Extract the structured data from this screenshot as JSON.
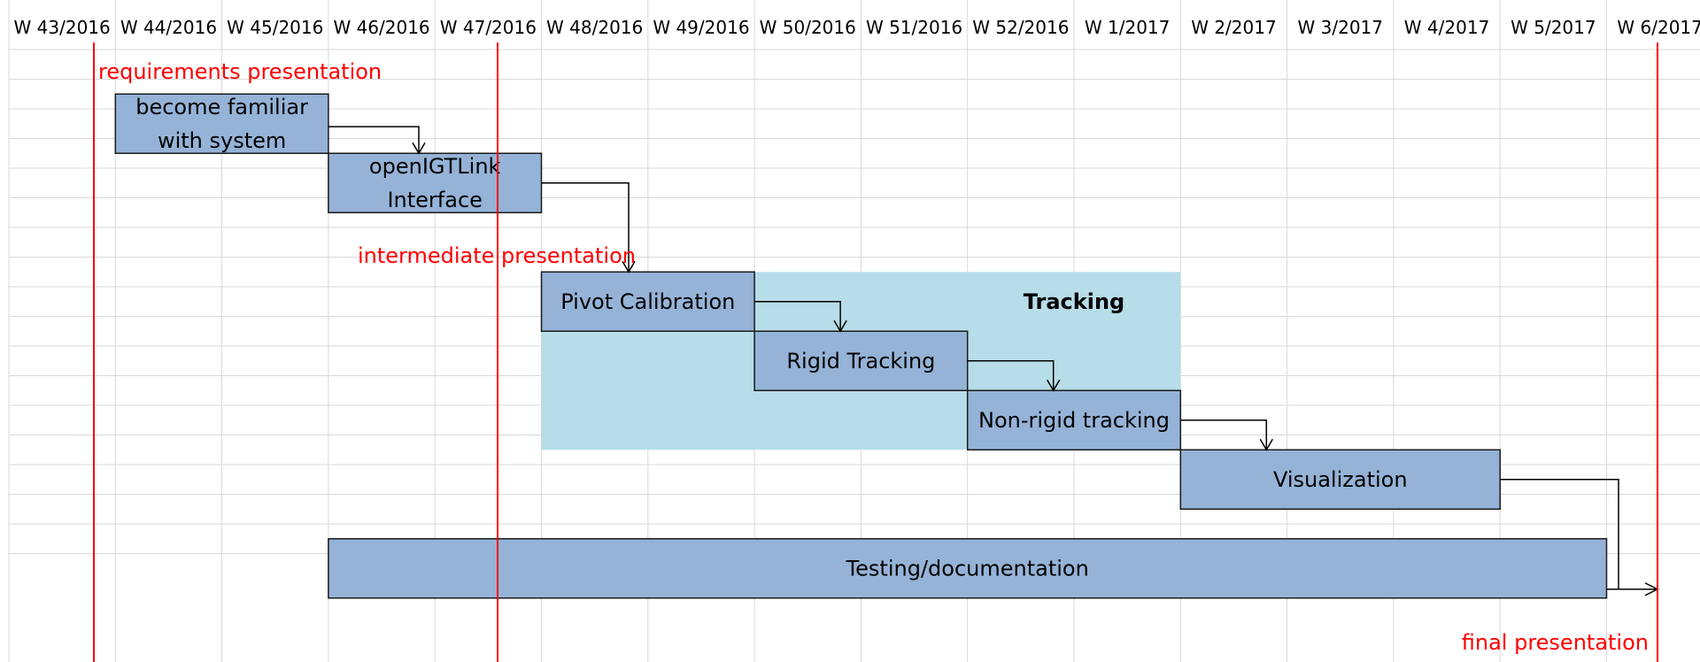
{
  "chart_data": {
    "type": "gantt",
    "weeks": [
      "W 43/2016",
      "W 44/2016",
      "W 45/2016",
      "W 46/2016",
      "W 47/2016",
      "W 48/2016",
      "W 49/2016",
      "W 50/2016",
      "W 51/2016",
      "W 52/2016",
      "W 1/2017",
      "W 2/2017",
      "W 3/2017",
      "W 4/2017",
      "W 5/2017",
      "W 6/2017"
    ],
    "tasks": [
      {
        "id": "familiar",
        "label_lines": [
          "become familiar",
          "with system"
        ],
        "start": "W 44/2016",
        "end": "W 45/2016"
      },
      {
        "id": "igtlink",
        "label_lines": [
          "openIGTLink",
          "Interface"
        ],
        "start": "W 46/2016",
        "end": "W 47/2016"
      },
      {
        "id": "pivot",
        "label_lines": [
          "Pivot Calibration"
        ],
        "start": "W 48/2016",
        "end": "W 49/2016"
      },
      {
        "id": "rigid",
        "label_lines": [
          "Rigid Tracking"
        ],
        "start": "W 50/2016",
        "end": "W 51/2016"
      },
      {
        "id": "nonrigid",
        "label_lines": [
          "Non-rigid tracking"
        ],
        "start": "W 52/2016",
        "end": "W 1/2017"
      },
      {
        "id": "viz",
        "label_lines": [
          "Visualization"
        ],
        "start": "W 2/2017",
        "end": "W 4/2017"
      },
      {
        "id": "testing",
        "label_lines": [
          "Testing/documentation"
        ],
        "start": "W 46/2016",
        "end": "W 5/2017"
      }
    ],
    "group": {
      "label": "Tracking",
      "start": "W 48/2016",
      "end": "W 2/2017"
    },
    "milestones": [
      {
        "id": "req",
        "label": "requirements presentation",
        "week": "W 43/2016"
      },
      {
        "id": "inter",
        "label": "intermediate presentation",
        "week": "W 47/2016"
      },
      {
        "id": "final",
        "label": "final presentation",
        "week": "W 6/2017"
      }
    ],
    "dependencies": [
      [
        "familiar",
        "igtlink"
      ],
      [
        "igtlink",
        "pivot"
      ],
      [
        "pivot",
        "rigid"
      ],
      [
        "rigid",
        "nonrigid"
      ],
      [
        "nonrigid",
        "viz"
      ],
      [
        "viz",
        "final"
      ],
      [
        "testing",
        "final"
      ]
    ],
    "colors": {
      "task": "#95b3d7",
      "group": "#b7dde8",
      "milestone": "#ff0000",
      "grid": "#d9d9d9"
    }
  }
}
